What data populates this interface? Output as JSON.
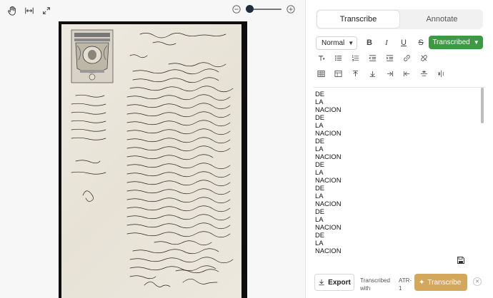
{
  "viewer": {
    "tools": [
      {
        "name": "hand-tool",
        "icon": "hand-icon"
      },
      {
        "name": "fit-width",
        "icon": "fit-width-icon"
      },
      {
        "name": "fullscreen",
        "icon": "expand-icon"
      }
    ],
    "zoom": {
      "level": 0.0,
      "minus_icon": "zoom-out-icon",
      "plus_icon": "zoom-in-icon"
    }
  },
  "panel": {
    "tabs": [
      {
        "label": "Transcribe",
        "active": true
      },
      {
        "label": "Annotate",
        "active": false
      }
    ],
    "format": {
      "style_select": "Normal",
      "status_label": "Transcribed",
      "status_color": "#3d9a42"
    },
    "text_lines": [
      "DE",
      "LA",
      "NACION",
      "DE",
      "LA",
      "NACION",
      "DE",
      "LA",
      "NACION",
      "DE",
      "LA",
      "NACION",
      "DE",
      "LA",
      "NACION",
      "DE",
      "LA",
      "NACION",
      "DE",
      "LA",
      "NACION"
    ],
    "footer": {
      "export_label": "Export",
      "transcribed_with_label": "Transcribed with",
      "model_label": "ATR-1",
      "transcribe_button_label": "Transcribe",
      "transcribe_color": "#d4a85c"
    }
  }
}
